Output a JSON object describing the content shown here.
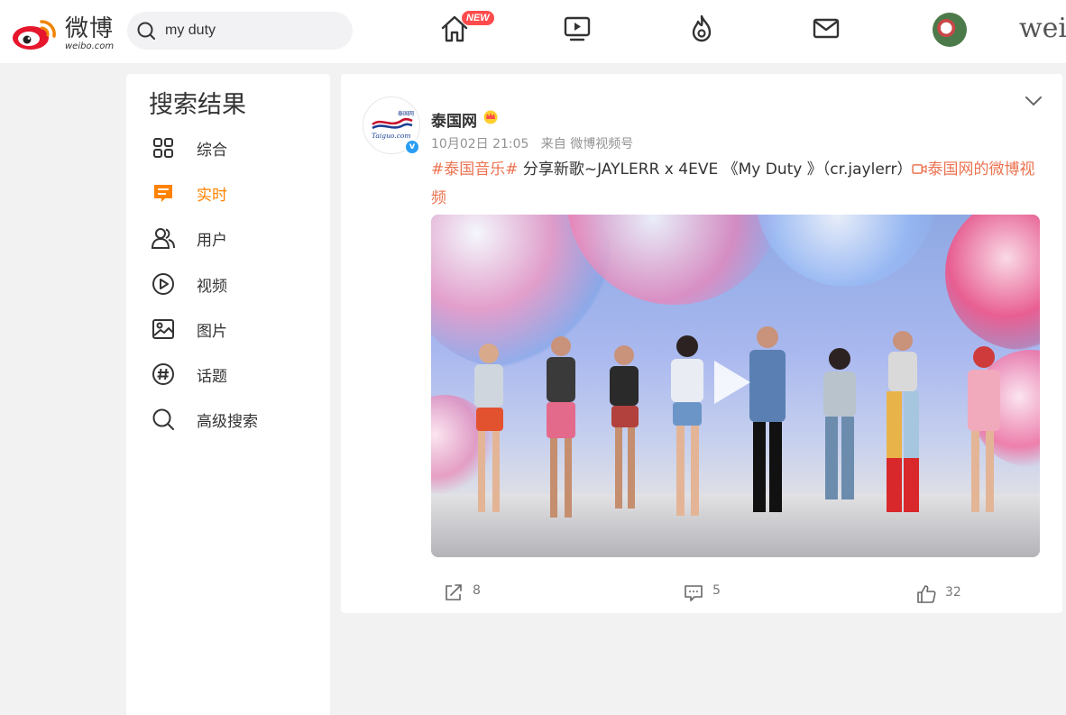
{
  "header": {
    "logo_text": "微博",
    "logo_sub": "weibo.com",
    "search_value": "my duty",
    "new_badge": "NEW",
    "trail_text": "weil"
  },
  "sidebar": {
    "title": "搜索结果",
    "items": [
      {
        "label": "综合",
        "icon": "grid-icon",
        "active": false
      },
      {
        "label": "实时",
        "icon": "realtime-icon",
        "active": true
      },
      {
        "label": "用户",
        "icon": "users-icon",
        "active": false
      },
      {
        "label": "视频",
        "icon": "play-circle-icon",
        "active": false
      },
      {
        "label": "图片",
        "icon": "image-icon",
        "active": false
      },
      {
        "label": "话题",
        "icon": "hashtag-icon",
        "active": false
      },
      {
        "label": "高级搜索",
        "icon": "search-icon",
        "active": false
      }
    ]
  },
  "post": {
    "author": "泰国网",
    "avatar_text": "泰国网",
    "avatar_script": "Taiguo.com",
    "time": "10月02日 21:05",
    "source": "来自 微博视频号",
    "hashtag": "#泰国音乐#",
    "body": " 分享新歌~JAYLERR x 4EVE 《My Duty 》（cr.jaylerr）",
    "video_link": "泰国网的微博视频",
    "reposts": "8",
    "comments": "5",
    "likes": "32"
  },
  "colors": {
    "accent": "#ff8200",
    "link": "#eb7350",
    "verified": "#2a9df4"
  }
}
